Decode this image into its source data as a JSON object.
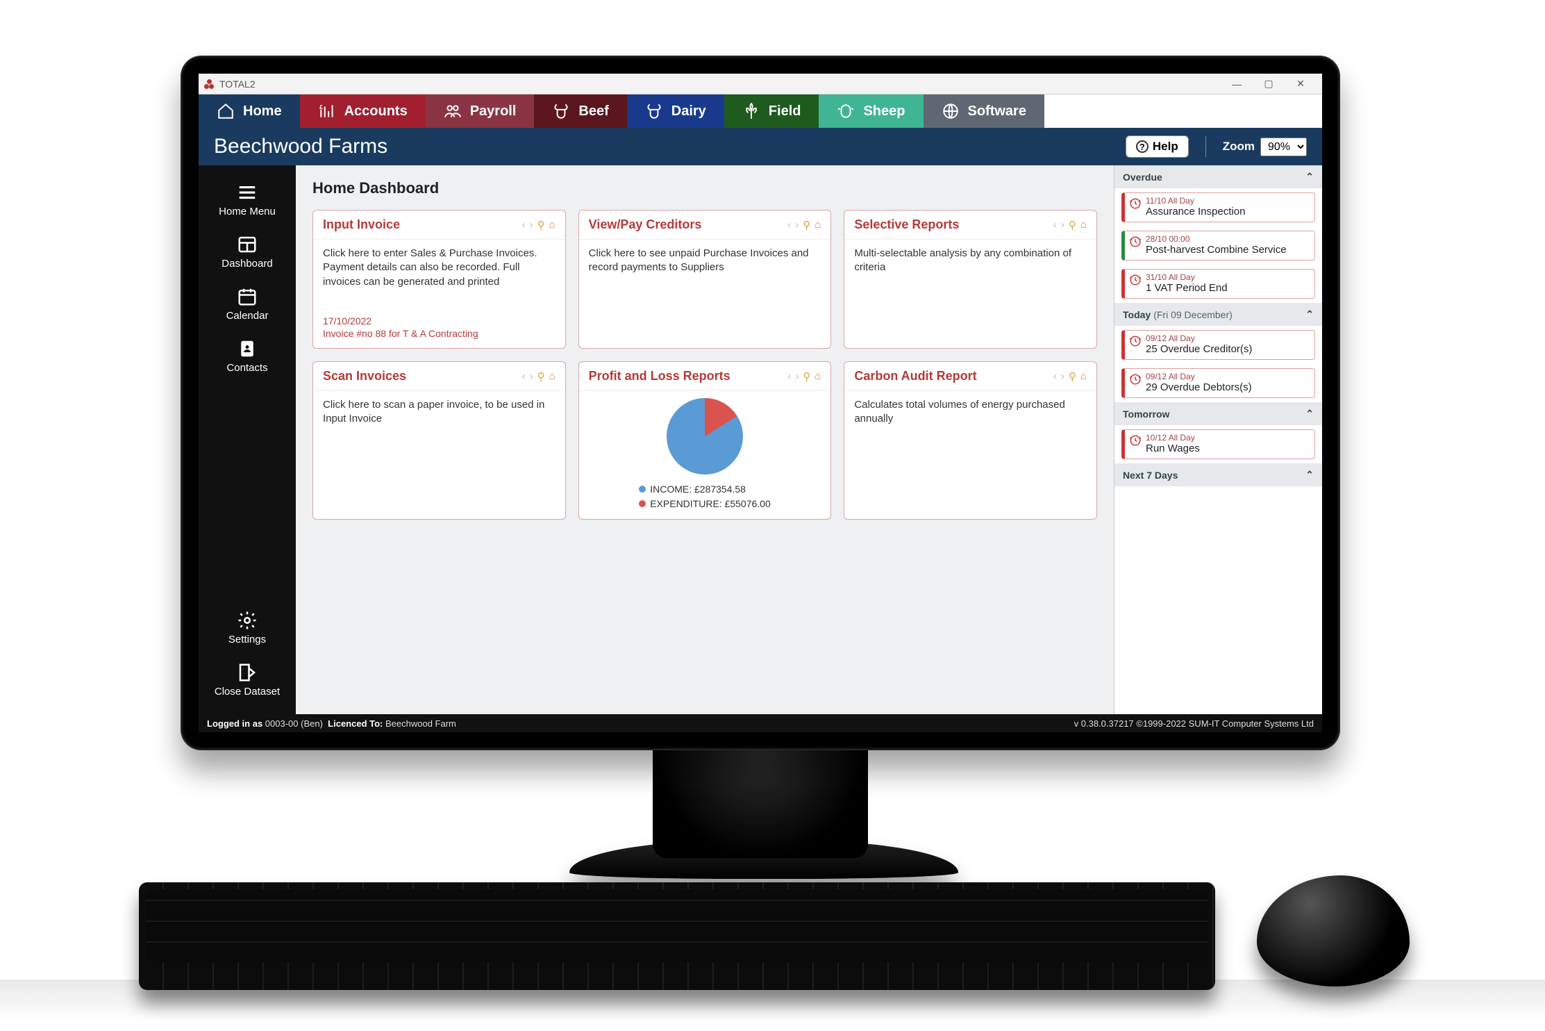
{
  "window": {
    "title": "TOTAL2",
    "minimize": "—",
    "maximize": "▢",
    "close": "✕"
  },
  "topnav": {
    "home": "Home",
    "accounts": "Accounts",
    "payroll": "Payroll",
    "beef": "Beef",
    "dairy": "Dairy",
    "field": "Field",
    "sheep": "Sheep",
    "software": "Software"
  },
  "subbar": {
    "company": "Beechwood Farms",
    "help": "Help",
    "zoom_label": "Zoom",
    "zoom_value": "90%"
  },
  "sidebar": {
    "home_menu": "Home Menu",
    "dashboard": "Dashboard",
    "calendar": "Calendar",
    "contacts": "Contacts",
    "settings": "Settings",
    "close_dataset": "Close Dataset"
  },
  "dashboard": {
    "heading": "Home Dashboard",
    "cards": [
      {
        "title": "Input Invoice",
        "body": "Click here to enter Sales & Purchase Invoices. Payment details can also be recorded. Full invoices can be generated and printed",
        "foot1": "17/10/2022",
        "foot2": "Invoice #no 88 for T & A Contracting"
      },
      {
        "title": "View/Pay Creditors",
        "body": "Click here to see unpaid Purchase Invoices and record payments to Suppliers"
      },
      {
        "title": "Selective Reports",
        "body": "Multi-selectable analysis by any combination of criteria"
      },
      {
        "title": "Scan Invoices",
        "body": "Click here to scan a paper invoice, to be used in Input Invoice"
      },
      {
        "title": "Profit and Loss Reports"
      },
      {
        "title": "Carbon Audit Report",
        "body": "Calculates total volumes of energy purchased annually"
      }
    ]
  },
  "chart_data": {
    "type": "pie",
    "series": [
      {
        "name": "INCOME",
        "value": 287354.58,
        "label": "INCOME: £287354.58",
        "color": "#5b9bd5"
      },
      {
        "name": "EXPENDITURE",
        "value": 55076.0,
        "label": "EXPENDITURE: £55076.00",
        "color": "#d9534f"
      }
    ]
  },
  "calendar": {
    "sections": [
      {
        "title": "Overdue",
        "items": [
          {
            "meta": "11/10 All Day",
            "title": "Assurance Inspection",
            "color": "red"
          },
          {
            "meta": "28/10 00:00",
            "title": "Post-harvest Combine Service",
            "color": "green"
          },
          {
            "meta": "31/10 All Day",
            "title": "1 VAT Period End",
            "color": "red"
          }
        ]
      },
      {
        "title": "Today",
        "suffix": "(Fri 09 December)",
        "items": [
          {
            "meta": "09/12 All Day",
            "title": "25 Overdue Creditor(s)",
            "color": "red"
          },
          {
            "meta": "09/12 All Day",
            "title": "29 Overdue Debtors(s)",
            "color": "red"
          }
        ]
      },
      {
        "title": "Tomorrow",
        "items": [
          {
            "meta": "10/12 All Day",
            "title": "Run Wages",
            "color": "red"
          }
        ]
      },
      {
        "title": "Next 7 Days",
        "items": []
      }
    ]
  },
  "statusbar": {
    "login_label": "Logged in as",
    "login_value": "0003-00 (Ben)",
    "licence_label": "Licenced To:",
    "licence_value": "Beechwood Farm",
    "right": "v 0.38.0.37217  ©1999-2022 SUM-IT Computer Systems Ltd"
  }
}
